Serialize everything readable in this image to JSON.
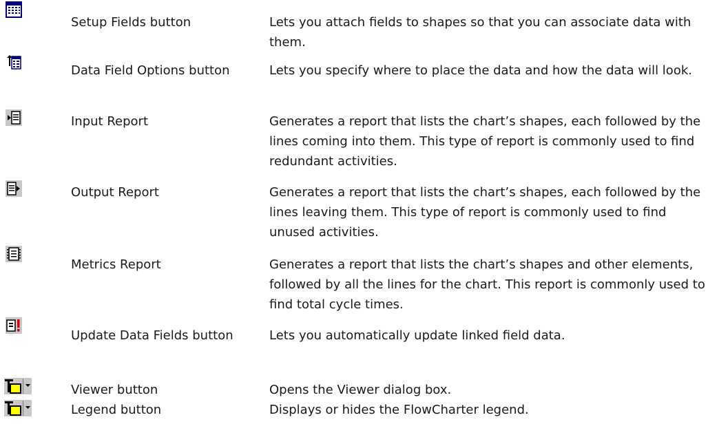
{
  "rows": [
    {
      "icon": "setup-fields-icon",
      "name": "Setup Fields button",
      "description": "Lets you attach fields to shapes so that you can associate data with them."
    },
    {
      "icon": "data-field-options-icon",
      "name": "Data Field Options button",
      "description": "Lets you specify where to place the data and how the data will look."
    },
    {
      "icon": "input-report-icon",
      "name": "Input Report",
      "description": "Generates a report that lists the chart’s shapes, each followed by the lines coming into them. This type of report is commonly used to find redundant activities."
    },
    {
      "icon": "output-report-icon",
      "name": "Output Report",
      "description": "Generates a report that lists the chart’s shapes, each followed by the lines leaving them. This type of report is commonly used to find unused activities."
    },
    {
      "icon": "metrics-report-icon",
      "name": "Metrics Report",
      "description": "Generates a report that lists the chart’s shapes and other elements, followed by all the lines for the chart. This report is commonly used to find total cycle times."
    },
    {
      "icon": "update-data-fields-icon",
      "name": "Update Data Fields button",
      "description": "Lets you automatically update linked field data."
    },
    {
      "icon": "viewer-icon",
      "name": "Viewer button",
      "description": "Opens the Viewer dialog box."
    },
    {
      "icon": "legend-icon",
      "name": "Legend button",
      "description": "Displays or hides the FlowCharter legend."
    }
  ]
}
